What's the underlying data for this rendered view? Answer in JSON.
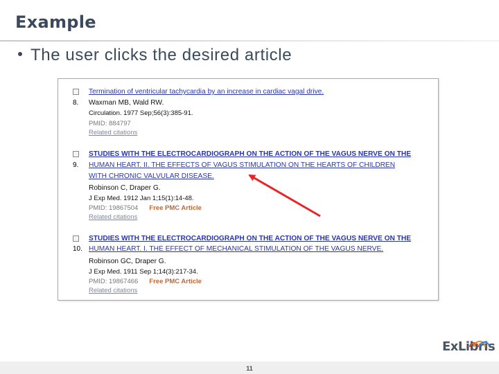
{
  "slide": {
    "title": "Example",
    "bullet": "The user clicks the desired article",
    "page_number": "11",
    "logo_text": "ExLibris"
  },
  "results": [
    {
      "number": "8.",
      "title_lines": [
        "Termination of ventricular tachycardia by an increase in cardiac vagal drive."
      ],
      "authors": "Waxman MB, Wald RW.",
      "citation": "Circulation. 1977 Sep;56(3):385-91.",
      "pmid": "PMID: 884797",
      "free_pmc": "",
      "related": "Related citations"
    },
    {
      "number": "9.",
      "title_lines": [
        "STUDIES WITH THE ELECTROCARDIOGRAPH ON THE ACTION OF THE VAGUS NERVE ON THE",
        "HUMAN HEART. II. THE EFFECTS OF VAGUS STIMULATION ON THE HEARTS OF CHILDREN",
        "WITH CHRONIC VALVULAR DISEASE."
      ],
      "authors": "Robinson C, Draper G.",
      "citation": "J Exp Med. 1912 Jan 1;15(1):14-48.",
      "pmid": "PMID: 19867504",
      "free_pmc": "Free PMC Article",
      "related": "Related citations"
    },
    {
      "number": "10.",
      "title_lines": [
        "STUDIES WITH THE ELECTROCARDIOGRAPH ON THE ACTION OF THE VAGUS NERVE ON THE",
        "HUMAN HEART. I. THE EFFECT OF MECHANICAL STIMULATION OF THE VAGUS NERVE."
      ],
      "authors": "Robinson GC, Draper G.",
      "citation": "J Exp Med. 1911 Sep 1;14(3):217-34.",
      "pmid": "PMID: 19867466",
      "free_pmc": "Free PMC Article",
      "related": "Related citations"
    }
  ]
}
